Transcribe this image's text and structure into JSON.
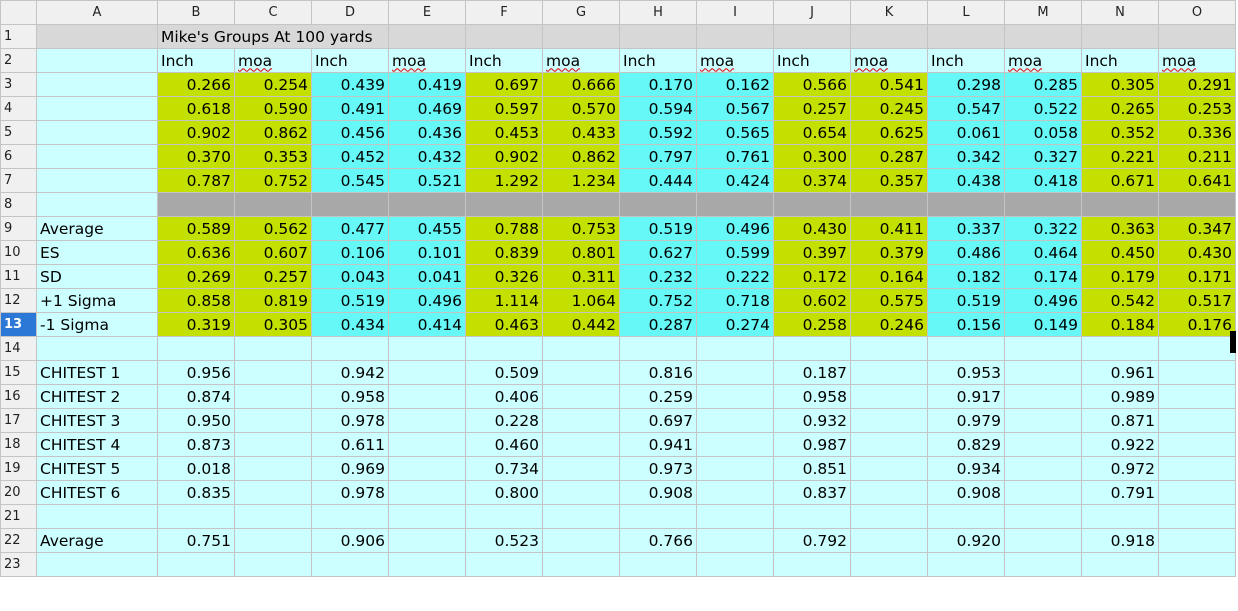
{
  "columns": [
    "A",
    "B",
    "C",
    "D",
    "E",
    "F",
    "G",
    "H",
    "I",
    "J",
    "K",
    "L",
    "M",
    "N",
    "O"
  ],
  "title": "Mike's Groups At 100 yards",
  "units": [
    "Inch",
    "moa",
    "Inch",
    "moa",
    "Inch",
    "moa",
    "Inch",
    "moa",
    "Inch",
    "moa",
    "Inch",
    "moa",
    "Inch",
    "moa"
  ],
  "data_rows": [
    [
      "0.266",
      "0.254",
      "0.439",
      "0.419",
      "0.697",
      "0.666",
      "0.170",
      "0.162",
      "0.566",
      "0.541",
      "0.298",
      "0.285",
      "0.305",
      "0.291"
    ],
    [
      "0.618",
      "0.590",
      "0.491",
      "0.469",
      "0.597",
      "0.570",
      "0.594",
      "0.567",
      "0.257",
      "0.245",
      "0.547",
      "0.522",
      "0.265",
      "0.253"
    ],
    [
      "0.902",
      "0.862",
      "0.456",
      "0.436",
      "0.453",
      "0.433",
      "0.592",
      "0.565",
      "0.654",
      "0.625",
      "0.061",
      "0.058",
      "0.352",
      "0.336"
    ],
    [
      "0.370",
      "0.353",
      "0.452",
      "0.432",
      "0.902",
      "0.862",
      "0.797",
      "0.761",
      "0.300",
      "0.287",
      "0.342",
      "0.327",
      "0.221",
      "0.211"
    ],
    [
      "0.787",
      "0.752",
      "0.545",
      "0.521",
      "1.292",
      "1.234",
      "0.444",
      "0.424",
      "0.374",
      "0.357",
      "0.438",
      "0.418",
      "0.671",
      "0.641"
    ]
  ],
  "stat_rows": [
    {
      "label": "Average",
      "values": [
        "0.589",
        "0.562",
        "0.477",
        "0.455",
        "0.788",
        "0.753",
        "0.519",
        "0.496",
        "0.430",
        "0.411",
        "0.337",
        "0.322",
        "0.363",
        "0.347"
      ]
    },
    {
      "label": "ES",
      "values": [
        "0.636",
        "0.607",
        "0.106",
        "0.101",
        "0.839",
        "0.801",
        "0.627",
        "0.599",
        "0.397",
        "0.379",
        "0.486",
        "0.464",
        "0.450",
        "0.430"
      ]
    },
    {
      "label": "SD",
      "values": [
        "0.269",
        "0.257",
        "0.043",
        "0.041",
        "0.326",
        "0.311",
        "0.232",
        "0.222",
        "0.172",
        "0.164",
        "0.182",
        "0.174",
        "0.179",
        "0.171"
      ]
    },
    {
      "label": "+1 Sigma",
      "values": [
        "0.858",
        "0.819",
        "0.519",
        "0.496",
        "1.114",
        "1.064",
        "0.752",
        "0.718",
        "0.602",
        "0.575",
        "0.519",
        "0.496",
        "0.542",
        "0.517"
      ]
    },
    {
      "label": "-1 Sigma",
      "values": [
        "0.319",
        "0.305",
        "0.434",
        "0.414",
        "0.463",
        "0.442",
        "0.287",
        "0.274",
        "0.258",
        "0.246",
        "0.156",
        "0.149",
        "0.184",
        "0.176"
      ]
    }
  ],
  "chitest_rows": [
    {
      "label": "CHITEST 1",
      "values": [
        "0.956",
        "0.942",
        "0.509",
        "0.816",
        "0.187",
        "0.953",
        "0.961"
      ]
    },
    {
      "label": "CHITEST 2",
      "values": [
        "0.874",
        "0.958",
        "0.406",
        "0.259",
        "0.958",
        "0.917",
        "0.989"
      ]
    },
    {
      "label": "CHITEST 3",
      "values": [
        "0.950",
        "0.978",
        "0.228",
        "0.697",
        "0.932",
        "0.979",
        "0.871"
      ]
    },
    {
      "label": "CHITEST 4",
      "values": [
        "0.873",
        "0.611",
        "0.460",
        "0.941",
        "0.987",
        "0.829",
        "0.922"
      ]
    },
    {
      "label": "CHITEST 5",
      "values": [
        "0.018",
        "0.969",
        "0.734",
        "0.973",
        "0.851",
        "0.934",
        "0.972"
      ]
    },
    {
      "label": "CHITEST 6",
      "values": [
        "0.835",
        "0.978",
        "0.800",
        "0.908",
        "0.837",
        "0.908",
        "0.791"
      ]
    }
  ],
  "average_row": {
    "label": "Average",
    "values": [
      "0.751",
      "0.906",
      "0.523",
      "0.766",
      "0.792",
      "0.920",
      "0.918"
    ]
  },
  "selected_row": "13",
  "colors": {
    "yellow_green": "#c4e000",
    "cyan": "#66f7f7",
    "light_cyan": "#ccffff",
    "gray": "#d8d8d8",
    "dark_gray": "#a8a8a8",
    "header": "#f0f0f0",
    "selected_header": "#2b78d6"
  }
}
